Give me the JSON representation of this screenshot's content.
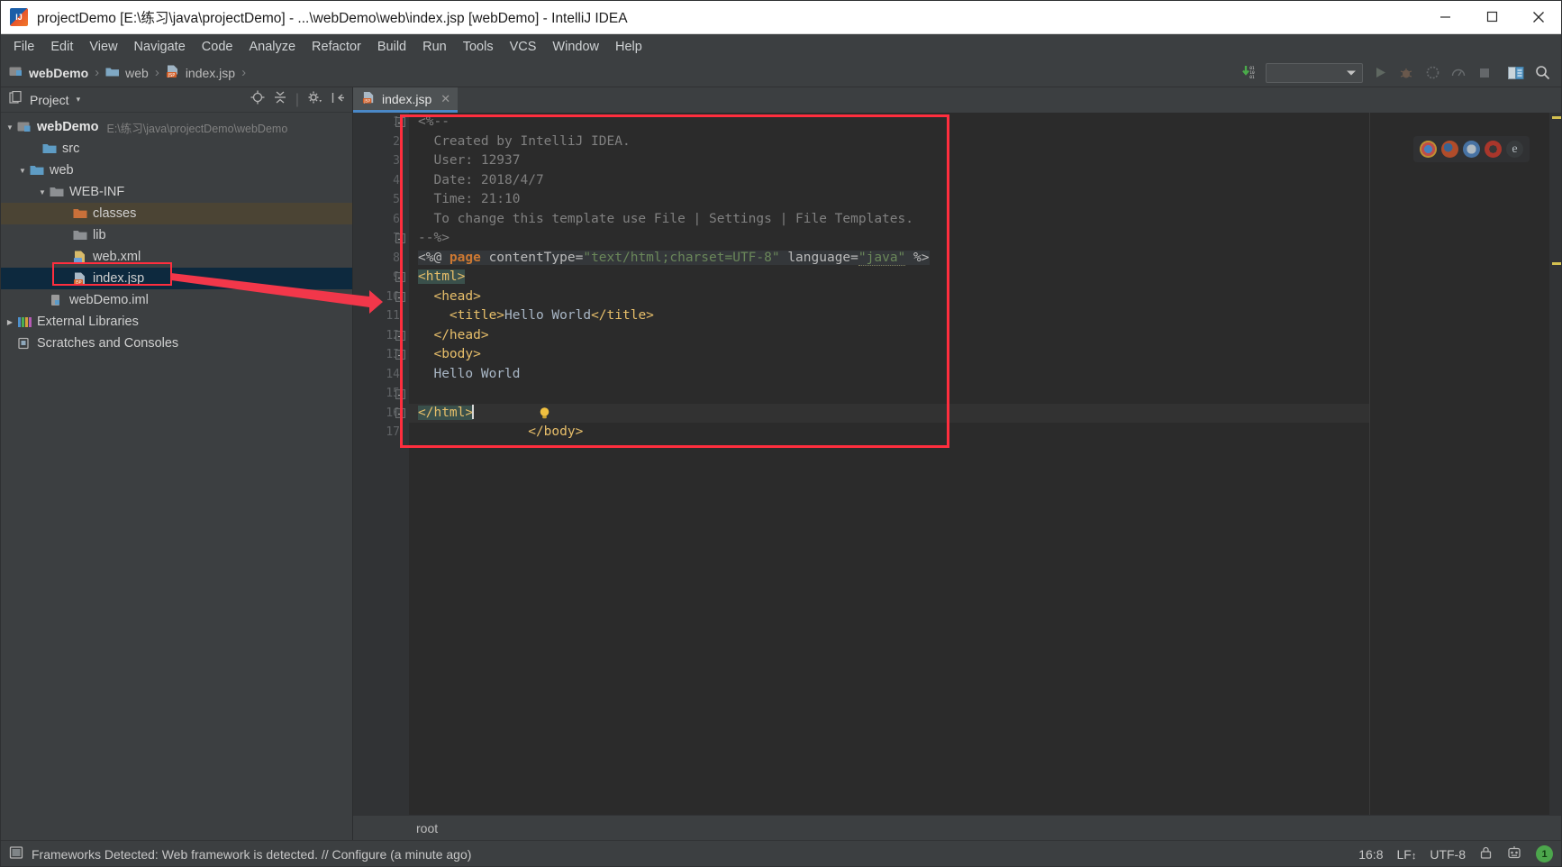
{
  "window": {
    "title": "projectDemo [E:\\练习\\java\\projectDemo] - ...\\webDemo\\web\\index.jsp [webDemo] - IntelliJ IDEA",
    "app_icon": "intellij-idea-icon",
    "minimize_label": "—",
    "maximize_label": "□",
    "close_label": "✕"
  },
  "menubar": {
    "items": [
      {
        "label": "File"
      },
      {
        "label": "Edit"
      },
      {
        "label": "View"
      },
      {
        "label": "Navigate"
      },
      {
        "label": "Code"
      },
      {
        "label": "Analyze"
      },
      {
        "label": "Refactor"
      },
      {
        "label": "Build"
      },
      {
        "label": "Run"
      },
      {
        "label": "Tools"
      },
      {
        "label": "VCS"
      },
      {
        "label": "Window"
      },
      {
        "label": "Help"
      }
    ]
  },
  "navbar": {
    "crumbs": [
      {
        "label": "webDemo",
        "icon": "module-icon"
      },
      {
        "label": "web",
        "icon": "folder-icon"
      },
      {
        "label": "index.jsp",
        "icon": "jsp-file-icon"
      }
    ],
    "separator": "›",
    "run_config_value": "",
    "run_config_placeholder": "",
    "icons": [
      {
        "name": "update-project-icon",
        "glyph": "⬇"
      },
      {
        "name": "run-icon",
        "glyph": "▶"
      },
      {
        "name": "debug-icon",
        "glyph": "🐞"
      },
      {
        "name": "run-with-coverage-icon",
        "glyph": "▦"
      },
      {
        "name": "profiler-icon",
        "glyph": "⏱"
      },
      {
        "name": "stop-icon",
        "glyph": "■"
      },
      {
        "name": "layout-icon",
        "glyph": "▤"
      },
      {
        "name": "search-everywhere-icon",
        "glyph": "🔍"
      }
    ]
  },
  "project_panel": {
    "title": "Project",
    "dropdown_caret": "▾",
    "toolbar_icons": [
      {
        "name": "locate-icon"
      },
      {
        "name": "collapse-all-icon"
      },
      {
        "name": "settings-gear-icon"
      },
      {
        "name": "hide-panel-icon"
      }
    ],
    "tree": [
      {
        "label": "webDemo",
        "sub": "E:\\练习\\java\\projectDemo\\webDemo",
        "icon": "module-icon",
        "arrow": "▼",
        "indent": 0,
        "bold": true,
        "state": "normal"
      },
      {
        "label": "src",
        "sub": "",
        "icon": "folder-blue-icon",
        "arrow": "",
        "indent": 1,
        "bold": false,
        "state": "normal"
      },
      {
        "label": "web",
        "sub": "",
        "icon": "folder-blue-icon",
        "arrow": "▼",
        "indent": 1,
        "bold": false,
        "state": "normal"
      },
      {
        "label": "WEB-INF",
        "sub": "",
        "icon": "folder-grey-icon",
        "arrow": "▼",
        "indent": 2,
        "bold": false,
        "state": "normal"
      },
      {
        "label": "classes",
        "sub": "",
        "icon": "folder-orange-icon",
        "arrow": "",
        "indent": 3,
        "bold": false,
        "state": "highlighted"
      },
      {
        "label": "lib",
        "sub": "",
        "icon": "folder-grey-icon",
        "arrow": "",
        "indent": 3,
        "bold": false,
        "state": "normal"
      },
      {
        "label": "web.xml",
        "sub": "",
        "icon": "xml-file-icon",
        "arrow": "",
        "indent": 3,
        "bold": false,
        "state": "normal"
      },
      {
        "label": "index.jsp",
        "sub": "",
        "icon": "jsp-file-icon",
        "arrow": "",
        "indent": 3,
        "bold": false,
        "state": "selected"
      },
      {
        "label": "webDemo.iml",
        "sub": "",
        "icon": "iml-file-icon",
        "arrow": "",
        "indent": 2,
        "bold": false,
        "state": "normal"
      },
      {
        "label": "External Libraries",
        "sub": "",
        "icon": "libraries-icon",
        "arrow": "▶",
        "indent": 0,
        "bold": false,
        "state": "normal"
      },
      {
        "label": "Scratches and Consoles",
        "sub": "",
        "icon": "scratches-icon",
        "arrow": "",
        "indent": 0,
        "bold": false,
        "state": "normal"
      }
    ]
  },
  "editor": {
    "tab": {
      "label": "index.jsp",
      "icon": "jsp-file-icon",
      "close_label": "✕"
    },
    "first_line_number": 1,
    "line_count": 17,
    "lines": [
      {
        "n": 1,
        "segments": [
          {
            "t": "<%--",
            "c": "c-comment"
          }
        ]
      },
      {
        "n": 2,
        "segments": [
          {
            "t": "  Created by IntelliJ IDEA.",
            "c": "c-comment"
          }
        ]
      },
      {
        "n": 3,
        "segments": [
          {
            "t": "  User: 12937",
            "c": "c-comment"
          }
        ]
      },
      {
        "n": 4,
        "segments": [
          {
            "t": "  Date: 2018/4/7",
            "c": "c-comment"
          }
        ]
      },
      {
        "n": 5,
        "segments": [
          {
            "t": "  Time: 21:10",
            "c": "c-comment"
          }
        ]
      },
      {
        "n": 6,
        "segments": [
          {
            "t": "  To change this template use File | Settings | File Templates.",
            "c": "c-comment"
          }
        ]
      },
      {
        "n": 7,
        "segments": [
          {
            "t": "--%>",
            "c": "c-comment"
          }
        ]
      },
      {
        "n": 8,
        "segments": [
          {
            "t": "<%@ ",
            "c": "c-attr c-jsp"
          },
          {
            "t": "page",
            "c": "c-kw c-jsp"
          },
          {
            "t": " contentType=",
            "c": "c-attr c-jsp"
          },
          {
            "t": "\"text/html;charset=UTF-8\"",
            "c": "c-str c-jsp"
          },
          {
            "t": " language=",
            "c": "c-attr c-jsp"
          },
          {
            "t": "\"java\"",
            "c": "c-str c-jsp"
          },
          {
            "t": " %>",
            "c": "c-attr c-jsp"
          }
        ]
      },
      {
        "n": 9,
        "segments": [
          {
            "t": "<html>",
            "c": "c-tag hl-html"
          }
        ]
      },
      {
        "n": 10,
        "segments": [
          {
            "t": "  <head>",
            "c": "c-tag"
          }
        ]
      },
      {
        "n": 11,
        "segments": [
          {
            "t": "    <title>",
            "c": "c-tag"
          },
          {
            "t": "Hello World",
            "c": "c-text"
          },
          {
            "t": "</title>",
            "c": "c-tag"
          }
        ]
      },
      {
        "n": 12,
        "segments": [
          {
            "t": "  </head>",
            "c": "c-tag"
          }
        ]
      },
      {
        "n": 13,
        "segments": [
          {
            "t": "  <body>",
            "c": "c-tag"
          }
        ]
      },
      {
        "n": 14,
        "segments": [
          {
            "t": "  Hello World",
            "c": "c-text"
          }
        ]
      },
      {
        "n": 15,
        "segments": [
          {
            "t": "  </body>",
            "c": "c-tag"
          }
        ]
      },
      {
        "n": 16,
        "segments": [
          {
            "t": "</html>",
            "c": "c-tag hl-html"
          }
        ]
      },
      {
        "n": 17,
        "segments": [
          {
            "t": "",
            "c": "c-text"
          }
        ]
      }
    ],
    "intention_bulb": {
      "name": "intention-bulb-icon",
      "line": 15
    },
    "caret_line": 16,
    "browsers": [
      {
        "name": "chrome-browser-icon",
        "color": "#d9a334"
      },
      {
        "name": "firefox-browser-icon",
        "color": "#c8522a"
      },
      {
        "name": "safari-browser-icon",
        "color": "#4c7fb8"
      },
      {
        "name": "opera-browser-icon",
        "color": "#c0392b"
      },
      {
        "name": "edge-browser-icon",
        "color": "#9aa7ad"
      }
    ],
    "root_label": "root"
  },
  "statusbar": {
    "message": "Frameworks Detected: Web framework is detected. // Configure (a minute ago)",
    "message_icon": "notification-icon",
    "caret_position": "16:8",
    "line_separator": "LF",
    "line_separator_caret": "↕",
    "encoding": "UTF-8",
    "lock_icon": "lock-icon",
    "inspector_icon": "inspector-face-icon",
    "notification_count": "1"
  },
  "annotations": {
    "code_box": {
      "name": "code-highlight-box",
      "color": "#ff2e3e"
    },
    "file_box": {
      "name": "file-highlight-box",
      "color": "#ff2e3e"
    },
    "arrow": {
      "name": "pointer-arrow",
      "color": "#f2374a"
    }
  }
}
